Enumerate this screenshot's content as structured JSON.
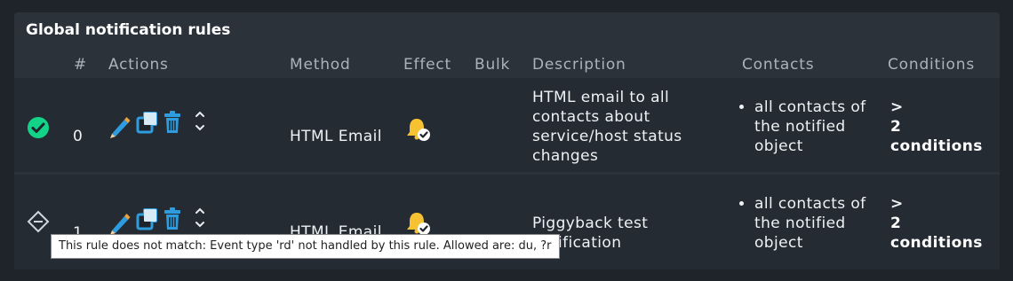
{
  "panel": {
    "title": "Global notification rules"
  },
  "columns": [
    "#",
    "Actions",
    "Method",
    "Effect",
    "Bulk",
    "Description",
    "Contacts",
    "Conditions"
  ],
  "rows": [
    {
      "status": "match",
      "status_icon": "check-circle-icon",
      "number": "0",
      "method": "HTML Email",
      "effect_icon": "bell-enabled-icon",
      "description": "HTML email to all contacts about service/host status changes",
      "contacts": [
        "all contacts of the notified object"
      ],
      "conditions": {
        "chevron": ">",
        "text": "2 conditions"
      }
    },
    {
      "status": "no-match",
      "status_icon": "no-match-diamond-icon",
      "number": "1",
      "method": "HTML Email",
      "effect_icon": "bell-enabled-icon",
      "description": "Piggyback test notification",
      "contacts": [
        "all contacts of the notified object"
      ],
      "conditions": {
        "chevron": ">",
        "text": "2 conditions"
      }
    }
  ],
  "tooltip": "This rule does not match: Event type 'rd' not handled by this rule. Allowed are: du, ?r",
  "colors": {
    "panel_bg": "#2b323a",
    "row_bg": "#242b33",
    "page_bg": "#1f242b",
    "match_green": "#13d389",
    "bell_yellow": "#f6c231",
    "edit_blue": "#2e9cdf"
  }
}
